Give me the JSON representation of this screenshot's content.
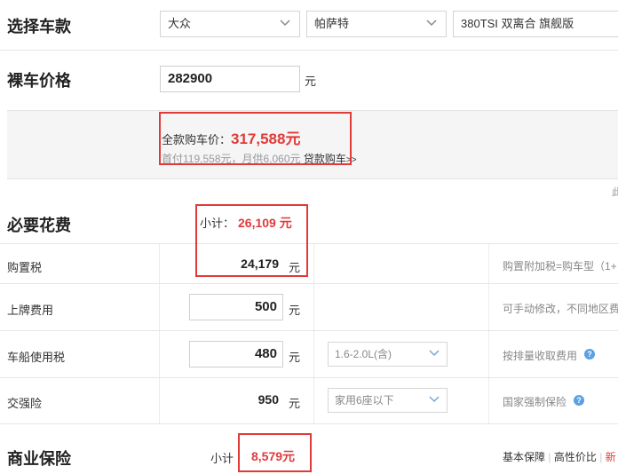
{
  "select_car": {
    "title": "选择车款",
    "brand": "大众",
    "series": "帕萨特",
    "model": "380TSI 双离合 旗舰版"
  },
  "bare_price": {
    "title": "裸车价格",
    "value": "282900",
    "unit": "元"
  },
  "full_price": {
    "label": "全款购车价：",
    "value": "317,588元",
    "loan_line": "首付119,558元，月供6,060元",
    "loan_link": "贷款购车",
    "loan_arrows": ">>"
  },
  "right_edge_char": "此",
  "required": {
    "title": "必要花费",
    "subtotal_label": "小计：",
    "subtotal_value": "26,109 元",
    "rows": [
      {
        "label": "购置税",
        "value": "24,179",
        "unit": "元",
        "note": "购置附加税=购车型（1+"
      },
      {
        "label": "上牌费用",
        "value": "500",
        "unit": "元",
        "note": "可手动修改，不同地区费"
      },
      {
        "label": "车船使用税",
        "value": "480",
        "unit": "元",
        "option": "1.6-2.0L(含)",
        "note": "按排量收取费用"
      },
      {
        "label": "交强险",
        "value": "950",
        "unit": "元",
        "option": "家用6座以下",
        "note": "国家强制保险"
      }
    ]
  },
  "insurance": {
    "title": "商业保险",
    "subtotal_label": "小计",
    "subtotal_value": "8,579元",
    "links": [
      "基本保障",
      "高性价比",
      "新"
    ],
    "separator": "|"
  },
  "icons": {
    "chevron": "chevron-down-icon",
    "help": "question-circle-icon"
  },
  "colors": {
    "accent_red": "#e03a3a",
    "help_blue": "#5aa0e6"
  }
}
